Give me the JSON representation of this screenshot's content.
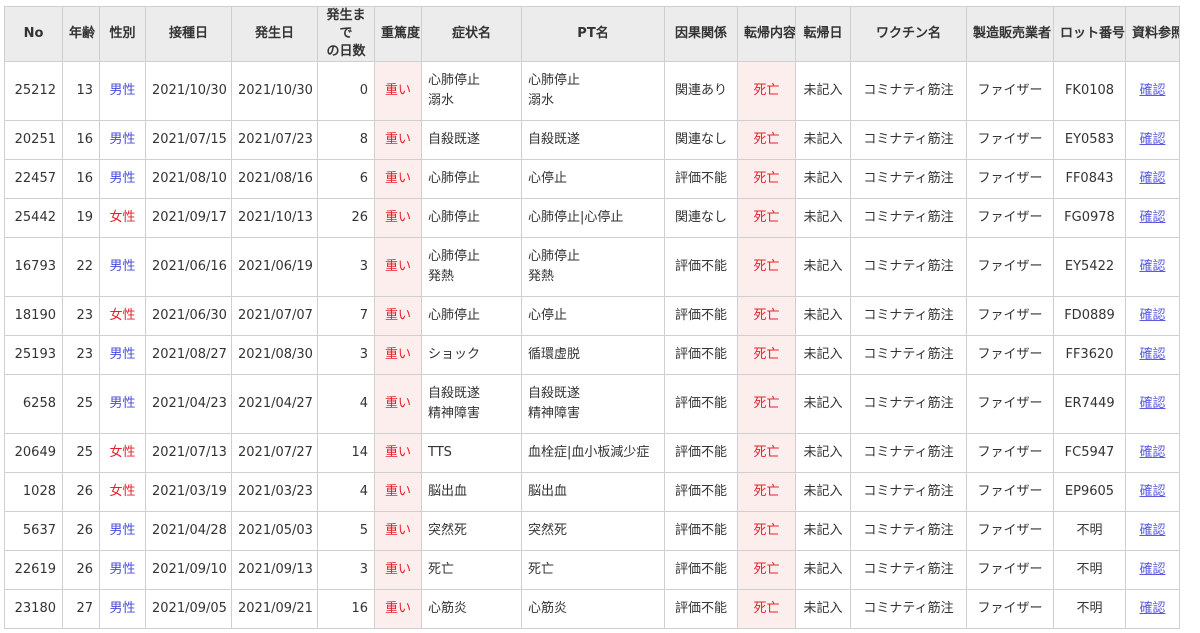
{
  "columns": [
    "No",
    "年齢",
    "性別",
    "接種日",
    "発生日",
    "発生まで\nの日数",
    "重篤度",
    "症状名",
    "PT名",
    "因果関係",
    "転帰内容",
    "転帰日",
    "ワクチン名",
    "製造販売業者",
    "ロット番号",
    "資料参照"
  ],
  "rows": [
    {
      "no": "25212",
      "age": "13",
      "sex": "男性",
      "vaccination_date": "2021/10/30",
      "onset_date": "2021/10/30",
      "days": "0",
      "severity": "重い",
      "symptoms": [
        "心肺停止",
        "溺水"
      ],
      "pt": [
        "心肺停止",
        "溺水"
      ],
      "causality": "関連あり",
      "outcome": "死亡",
      "outcome_date": "未記入",
      "vaccine": "コミナティ筋注",
      "maker": "ファイザー",
      "lot": "FK0108",
      "ref": "確認"
    },
    {
      "no": "20251",
      "age": "16",
      "sex": "男性",
      "vaccination_date": "2021/07/15",
      "onset_date": "2021/07/23",
      "days": "8",
      "severity": "重い",
      "symptoms": [
        "自殺既遂"
      ],
      "pt": [
        "自殺既遂"
      ],
      "causality": "関連なし",
      "outcome": "死亡",
      "outcome_date": "未記入",
      "vaccine": "コミナティ筋注",
      "maker": "ファイザー",
      "lot": "EY0583",
      "ref": "確認"
    },
    {
      "no": "22457",
      "age": "16",
      "sex": "男性",
      "vaccination_date": "2021/08/10",
      "onset_date": "2021/08/16",
      "days": "6",
      "severity": "重い",
      "symptoms": [
        "心肺停止"
      ],
      "pt": [
        "心停止"
      ],
      "causality": "評価不能",
      "outcome": "死亡",
      "outcome_date": "未記入",
      "vaccine": "コミナティ筋注",
      "maker": "ファイザー",
      "lot": "FF0843",
      "ref": "確認"
    },
    {
      "no": "25442",
      "age": "19",
      "sex": "女性",
      "vaccination_date": "2021/09/17",
      "onset_date": "2021/10/13",
      "days": "26",
      "severity": "重い",
      "symptoms": [
        "心肺停止"
      ],
      "pt": [
        "心肺停止|心停止"
      ],
      "causality": "関連なし",
      "outcome": "死亡",
      "outcome_date": "未記入",
      "vaccine": "コミナティ筋注",
      "maker": "ファイザー",
      "lot": "FG0978",
      "ref": "確認"
    },
    {
      "no": "16793",
      "age": "22",
      "sex": "男性",
      "vaccination_date": "2021/06/16",
      "onset_date": "2021/06/19",
      "days": "3",
      "severity": "重い",
      "symptoms": [
        "心肺停止",
        "発熱"
      ],
      "pt": [
        "心肺停止",
        "発熱"
      ],
      "causality": "評価不能",
      "outcome": "死亡",
      "outcome_date": "未記入",
      "vaccine": "コミナティ筋注",
      "maker": "ファイザー",
      "lot": "EY5422",
      "ref": "確認"
    },
    {
      "no": "18190",
      "age": "23",
      "sex": "女性",
      "vaccination_date": "2021/06/30",
      "onset_date": "2021/07/07",
      "days": "7",
      "severity": "重い",
      "symptoms": [
        "心肺停止"
      ],
      "pt": [
        "心停止"
      ],
      "causality": "評価不能",
      "outcome": "死亡",
      "outcome_date": "未記入",
      "vaccine": "コミナティ筋注",
      "maker": "ファイザー",
      "lot": "FD0889",
      "ref": "確認"
    },
    {
      "no": "25193",
      "age": "23",
      "sex": "男性",
      "vaccination_date": "2021/08/27",
      "onset_date": "2021/08/30",
      "days": "3",
      "severity": "重い",
      "symptoms": [
        "ショック"
      ],
      "pt": [
        "循環虚脱"
      ],
      "causality": "評価不能",
      "outcome": "死亡",
      "outcome_date": "未記入",
      "vaccine": "コミナティ筋注",
      "maker": "ファイザー",
      "lot": "FF3620",
      "ref": "確認"
    },
    {
      "no": "6258",
      "age": "25",
      "sex": "男性",
      "vaccination_date": "2021/04/23",
      "onset_date": "2021/04/27",
      "days": "4",
      "severity": "重い",
      "symptoms": [
        "自殺既遂",
        "精神障害"
      ],
      "pt": [
        "自殺既遂",
        "精神障害"
      ],
      "causality": "評価不能",
      "outcome": "死亡",
      "outcome_date": "未記入",
      "vaccine": "コミナティ筋注",
      "maker": "ファイザー",
      "lot": "ER7449",
      "ref": "確認"
    },
    {
      "no": "20649",
      "age": "25",
      "sex": "女性",
      "vaccination_date": "2021/07/13",
      "onset_date": "2021/07/27",
      "days": "14",
      "severity": "重い",
      "symptoms": [
        "TTS"
      ],
      "pt": [
        "血栓症|血小板減少症"
      ],
      "causality": "評価不能",
      "outcome": "死亡",
      "outcome_date": "未記入",
      "vaccine": "コミナティ筋注",
      "maker": "ファイザー",
      "lot": "FC5947",
      "ref": "確認"
    },
    {
      "no": "1028",
      "age": "26",
      "sex": "女性",
      "vaccination_date": "2021/03/19",
      "onset_date": "2021/03/23",
      "days": "4",
      "severity": "重い",
      "symptoms": [
        "脳出血"
      ],
      "pt": [
        "脳出血"
      ],
      "causality": "評価不能",
      "outcome": "死亡",
      "outcome_date": "未記入",
      "vaccine": "コミナティ筋注",
      "maker": "ファイザー",
      "lot": "EP9605",
      "ref": "確認"
    },
    {
      "no": "5637",
      "age": "26",
      "sex": "男性",
      "vaccination_date": "2021/04/28",
      "onset_date": "2021/05/03",
      "days": "5",
      "severity": "重い",
      "symptoms": [
        "突然死"
      ],
      "pt": [
        "突然死"
      ],
      "causality": "評価不能",
      "outcome": "死亡",
      "outcome_date": "未記入",
      "vaccine": "コミナティ筋注",
      "maker": "ファイザー",
      "lot": "不明",
      "ref": "確認"
    },
    {
      "no": "22619",
      "age": "26",
      "sex": "男性",
      "vaccination_date": "2021/09/10",
      "onset_date": "2021/09/13",
      "days": "3",
      "severity": "重い",
      "symptoms": [
        "死亡"
      ],
      "pt": [
        "死亡"
      ],
      "causality": "評価不能",
      "outcome": "死亡",
      "outcome_date": "未記入",
      "vaccine": "コミナティ筋注",
      "maker": "ファイザー",
      "lot": "不明",
      "ref": "確認"
    },
    {
      "no": "23180",
      "age": "27",
      "sex": "男性",
      "vaccination_date": "2021/09/05",
      "onset_date": "2021/09/21",
      "days": "16",
      "severity": "重い",
      "symptoms": [
        "心筋炎"
      ],
      "pt": [
        "心筋炎"
      ],
      "causality": "評価不能",
      "outcome": "死亡",
      "outcome_date": "未記入",
      "vaccine": "コミナティ筋注",
      "maker": "ファイザー",
      "lot": "不明",
      "ref": "確認"
    }
  ],
  "colors": {
    "header_bg": "#ececec",
    "severe_bg": "#fdeeee",
    "severe_text": "#e8202a",
    "male_text": "#4b4bd8",
    "female_text": "#e8202a",
    "link": "#5b5be0",
    "border": "#cfcfcf"
  }
}
